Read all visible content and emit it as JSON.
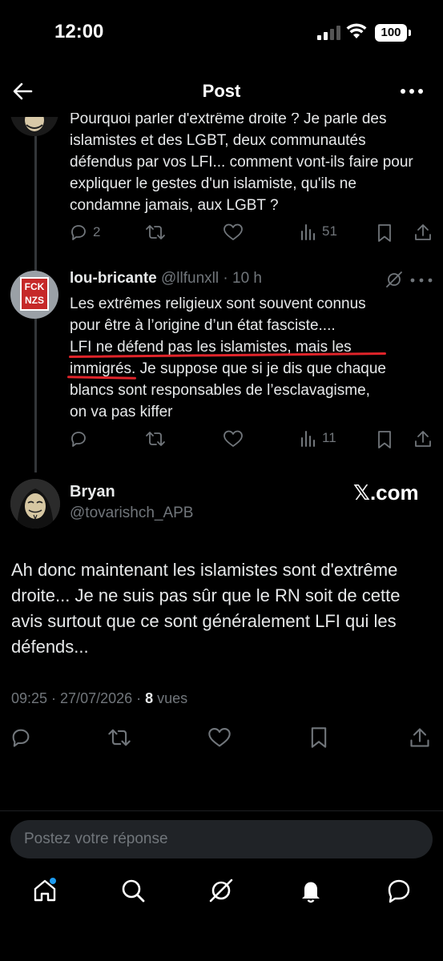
{
  "status_bar": {
    "time": "12:00",
    "battery": "100"
  },
  "header": {
    "title": "Post"
  },
  "tweet_top": {
    "text": "Pourquoi parler d'extrême droite ? Je parle des islamistes et des LGBT, deux communautés défendus par vos LFI... comment vont-ils faire pour expliquer le gestes d'un islamiste, qu'ils ne condamne jamais, aux LGBT ?",
    "replies": "2",
    "views": "51"
  },
  "tweet_lou": {
    "name": "lou-bricante",
    "handle": "@llfunxll",
    "time": "· 10 h",
    "avatar_text": "FCK NZS",
    "lines": [
      "Les extrêmes religieux sont souvent connus",
      "pour être à l’origine d’un état fasciste....",
      "LFI ne défend pas les islamistes, mais les",
      "immigrés. Je suppose que si je dis que chaque",
      "blancs sont responsables de l’esclavagisme,",
      "on va pas kiffer"
    ],
    "views": "11"
  },
  "main_tweet": {
    "name": "Bryan",
    "handle": "@tovarishch_APB",
    "watermark": "𝕏.com",
    "text": "Ah donc maintenant les islamistes sont d'extrême droite... Je ne suis pas sûr que le RN soit de cette avis surtout que ce sont généralement LFI qui les défends...",
    "datetime": "09:25 · 27/07/2026 · ",
    "views_count": "8",
    "views_label": " vues"
  },
  "reply": {
    "placeholder": "Postez votre réponse"
  },
  "nav": [
    "home-icon",
    "search-icon",
    "grok-icon",
    "notifications-icon",
    "messages-icon"
  ],
  "colors": {
    "background": "#000000",
    "text": "#e7e9ea",
    "muted": "#71767b",
    "underline": "#e0242a",
    "accent": "#1d9bf0"
  }
}
